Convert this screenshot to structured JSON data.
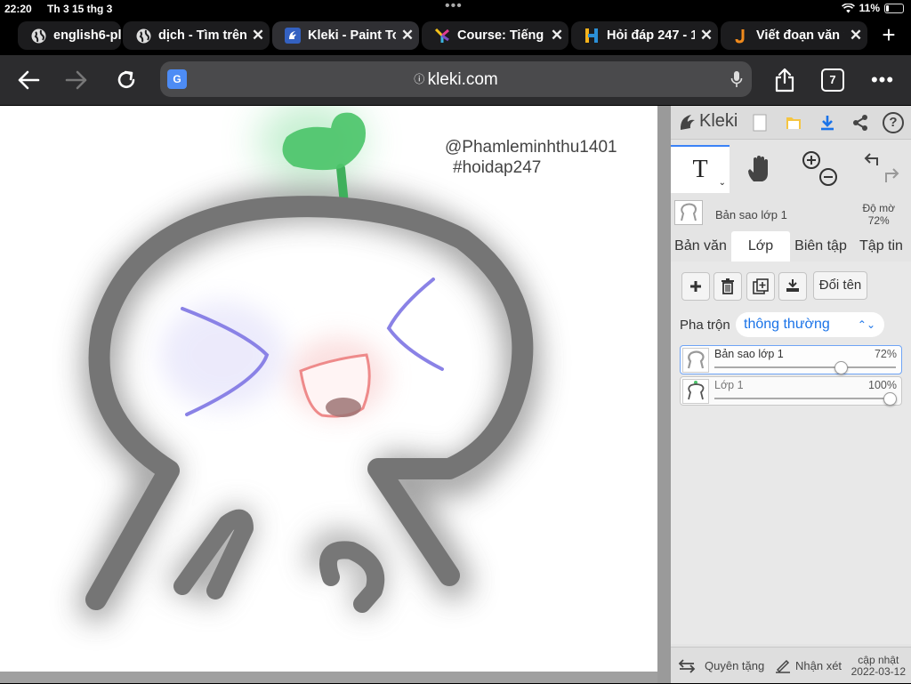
{
  "status": {
    "time": "22:20",
    "date": "Th 3 15 thg 3",
    "battery": "11%"
  },
  "tabs": [
    {
      "label": "english6-pl",
      "icon": "globe-icon",
      "active": false
    },
    {
      "label": "dịch - Tìm trên",
      "icon": "globe-icon",
      "active": false
    },
    {
      "label": "Kleki - Paint To",
      "icon": "kleki-icon",
      "active": true
    },
    {
      "label": "Course: Tiếng",
      "icon": "course-icon",
      "active": false
    },
    {
      "label": "Hỏi đáp 247 - 1",
      "icon": "hoidap-icon",
      "active": false
    },
    {
      "label": "Viết đoạn văn p",
      "icon": "j-icon",
      "active": false
    }
  ],
  "nav": {
    "url": "kleki.com",
    "tab_count": "7"
  },
  "canvas": {
    "watermark_line1": "@Phamleminhthu1401",
    "watermark_line2": "#hoidap247"
  },
  "panel": {
    "logo": "Kleki",
    "tool_text": "T",
    "current_layer": {
      "name": "Bản sao lớp 1",
      "opacity_label": "Độ mờ",
      "opacity_value": "72%"
    },
    "tabs": [
      "Bản văn",
      "Lớp",
      "Biên tập",
      "Tập tin"
    ],
    "active_tab": "Lớp",
    "rename_label": "Đổi tên",
    "blend_label": "Pha trộn",
    "blend_value": "thông thường",
    "layers": [
      {
        "name": "Bản sao lớp 1",
        "opacity": "72%",
        "opacity_value": 0.72,
        "selected": true
      },
      {
        "name": "Lớp 1",
        "opacity": "100%",
        "opacity_value": 1.0,
        "selected": false
      }
    ],
    "footer": {
      "license": "Quyên tặng",
      "feedback": "Nhận xét",
      "update_label": "cập nhật",
      "update_date": "2022-03-12"
    }
  }
}
